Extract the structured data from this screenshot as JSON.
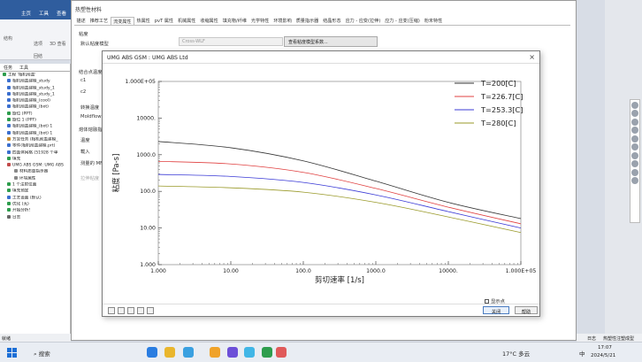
{
  "app": {
    "tabs": [
      "主页",
      "工具",
      "查看"
    ],
    "ribbon_items": [
      "结构",
      "选项",
      "3D 查看",
      "局部",
      "回结"
    ],
    "left_tabs": [
      "任务",
      "工具"
    ],
    "tree": [
      "工程 '相机前盖'",
      "相机前盖建模_study",
      "相机前盖建模_study_1",
      "相机前盖建模_study_1",
      "相机前盖建模_(cool)",
      "相机前盖建模_(bot)",
      "旋位 (PPT)",
      "旋位 1 (PPT)",
      "相机前盖建模_(bot) 1",
      "相机前盖建模_(bot) 1",
      "方案任务 (相机前盖建模_",
      "零件(相机前盖建模.prt)",
      "四面体网格 (51928 个单",
      "填充",
      "UMG ABS GSM: UMG ABS",
      "材料质量指示器",
      "环境属性",
      "1 个注射位置",
      "填充预定",
      "工艺设置 (默认)",
      "优化 (无)",
      "开始分析!",
      "日志"
    ],
    "status_left": "就绪"
  },
  "props": {
    "title": "热塑性材料",
    "tabs": [
      "描述",
      "推荐工艺",
      "流变属性",
      "热属性",
      "pvT 属性",
      "机械属性",
      "收缩属性",
      "填充物/纤维",
      "光学特性",
      "环境影响",
      "质量指示器",
      "结晶形态",
      "应力 - 应变(拉伸)",
      "应力 - 应变(压缩)",
      "粉末特性"
    ],
    "labels": {
      "viscosity": "粘度",
      "viscosity_model": "默认粘度模型",
      "model_value": "Cross-WLF",
      "view_btn": "查看粘度模型系数...",
      "juncture": "结合点温度",
      "c1": "c1",
      "c2": "c2",
      "transition": "转换温度",
      "moldflow": "Moldflow",
      "section": "熔体熔融指数",
      "temp": "温度",
      "load": "载入",
      "measured": "测量的 MF",
      "option": "拉伸粘度"
    }
  },
  "chart_dialog": {
    "title": "UMG ABS GSM : UMG ABS Ltd",
    "close": "×",
    "show_points": "显示点",
    "close_btn": "关闭",
    "help_btn": "帮助"
  },
  "chart_data": {
    "type": "line",
    "xlabel": "剪切速率 [1/s]",
    "ylabel": "粘度 [Pa-s]",
    "x_scale": "log",
    "y_scale": "log",
    "xlim": [
      1,
      100000
    ],
    "ylim": [
      1,
      100000
    ],
    "x_ticks": [
      "1.000",
      "10.00",
      "100.0",
      "1000.0",
      "10000.",
      "1.000E+05"
    ],
    "y_ticks": [
      "1.000E+05",
      "10000.",
      "1000.0",
      "100.0",
      "10.00",
      "1.000"
    ],
    "legend_position": "top-right",
    "series": [
      {
        "name": "T=200[C]",
        "color": "#333333",
        "x": [
          1,
          10,
          100,
          1000,
          10000,
          100000
        ],
        "y": [
          2300,
          1550,
          680,
          190,
          50,
          18
        ]
      },
      {
        "name": "T=226.7[C]",
        "color": "#e04040",
        "x": [
          1,
          10,
          100,
          1000,
          10000,
          100000
        ],
        "y": [
          660,
          560,
          330,
          120,
          37,
          13
        ]
      },
      {
        "name": "T=253.3[C]",
        "color": "#3b3bd6",
        "x": [
          1,
          10,
          100,
          1000,
          10000,
          100000
        ],
        "y": [
          290,
          255,
          175,
          80,
          28,
          10
        ]
      },
      {
        "name": "T=280[C]",
        "color": "#9a9a2a",
        "x": [
          1,
          10,
          100,
          1000,
          10000,
          100000
        ],
        "y": [
          140,
          125,
          95,
          50,
          20,
          7.5
        ]
      }
    ]
  },
  "taskbar": {
    "search": "搜索",
    "weather": "17°C 多云",
    "ime": "中",
    "time": "17:07",
    "date": "2024/5/21"
  },
  "right_status": [
    "日志",
    "热塑性注塑成型"
  ]
}
